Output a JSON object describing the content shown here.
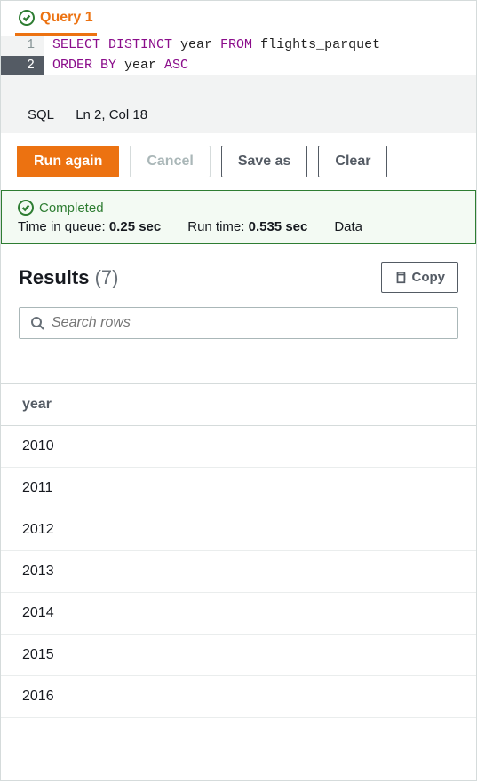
{
  "tab": {
    "label": "Query 1"
  },
  "editor": {
    "lines": [
      {
        "num": "1",
        "kw1": "SELECT DISTINCT",
        "rest1": " year ",
        "kw2": "FROM",
        "rest2": " flights_parquet"
      },
      {
        "num": "2",
        "kw1": "ORDER BY",
        "rest1": " year ",
        "kw2": "ASC",
        "rest2": ""
      }
    ]
  },
  "statusbar": {
    "lang": "SQL",
    "pos": "Ln 2, Col 18"
  },
  "toolbar": {
    "run": "Run again",
    "cancel": "Cancel",
    "saveas": "Save as",
    "clear": "Clear"
  },
  "status": {
    "state": "Completed",
    "queue_label": "Time in queue:",
    "queue_value": "0.25 sec",
    "runtime_label": "Run time:",
    "runtime_value": "0.535 sec",
    "data_label": "Data "
  },
  "results": {
    "title": "Results",
    "count": "(7)",
    "copy": "Copy",
    "search_placeholder": "Search rows",
    "column": "year",
    "rows": [
      "2010",
      "2011",
      "2012",
      "2013",
      "2014",
      "2015",
      "2016"
    ]
  }
}
